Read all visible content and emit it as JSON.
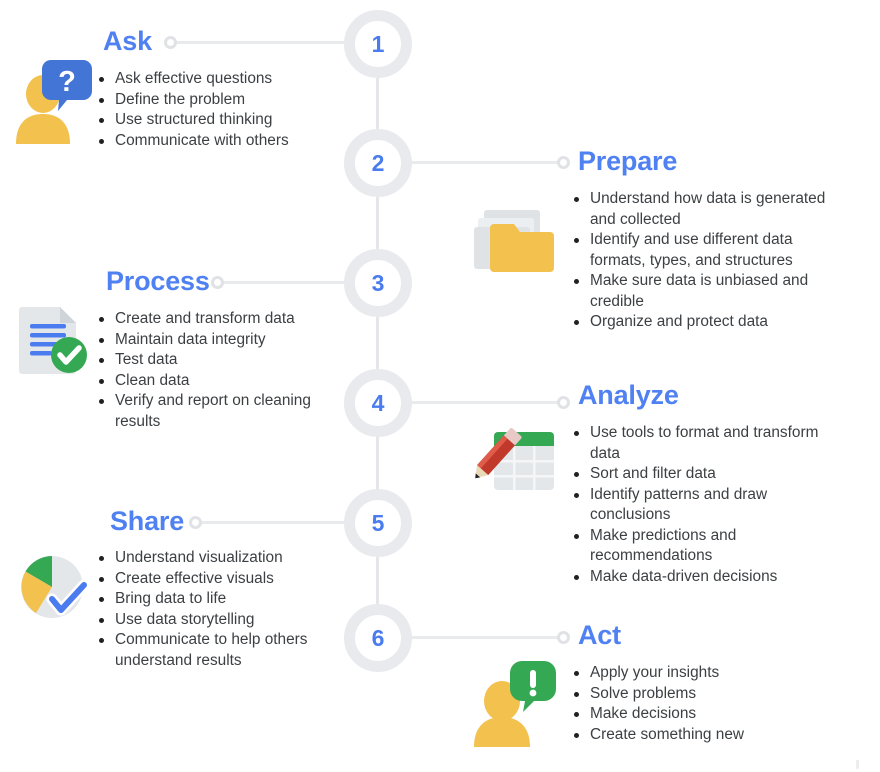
{
  "meta": {
    "title": "Data Analysis Process — Six Phases",
    "accent_blue": "#5081f2",
    "number_blue": "#4a7cf0",
    "ring_gray": "#e8eaed",
    "text_dark": "#3c4043",
    "icon_yellow": "#f2c14e",
    "icon_green": "#34a853",
    "icon_red": "#c0392b",
    "icon_gray": "#dadce0"
  },
  "steps": [
    {
      "number": "1",
      "title": "Ask",
      "side": "left",
      "icon": "person-question-icon",
      "bullets": [
        "Ask effective questions",
        "Define the problem",
        "Use structured thinking",
        "Communicate with others"
      ]
    },
    {
      "number": "2",
      "title": "Prepare",
      "side": "right",
      "icon": "folder-files-icon",
      "bullets": [
        "Understand how data is generated and collected",
        "Identify and use different data formats, types, and structures",
        "Make sure data is unbiased and credible",
        "Organize and protect data"
      ]
    },
    {
      "number": "3",
      "title": "Process",
      "side": "left",
      "icon": "document-check-icon",
      "bullets": [
        "Create and transform data",
        "Maintain data integrity",
        "Test data",
        "Clean data",
        "Verify and report on cleaning results"
      ]
    },
    {
      "number": "4",
      "title": "Analyze",
      "side": "right",
      "icon": "spreadsheet-pencil-icon",
      "bullets": [
        "Use tools to format and transform data",
        "Sort and filter data",
        "Identify patterns and draw conclusions",
        "Make predictions and recommendations",
        "Make data-driven decisions"
      ]
    },
    {
      "number": "5",
      "title": "Share",
      "side": "left",
      "icon": "pie-chart-check-icon",
      "bullets": [
        "Understand visualization",
        "Create effective visuals",
        "Bring data to life",
        "Use data storytelling",
        "Communicate to help others understand results"
      ]
    },
    {
      "number": "6",
      "title": "Act",
      "side": "right",
      "icon": "person-exclaim-icon",
      "bullets": [
        "Apply your insights",
        "Solve problems",
        "Make decisions",
        "Create something new"
      ]
    }
  ]
}
